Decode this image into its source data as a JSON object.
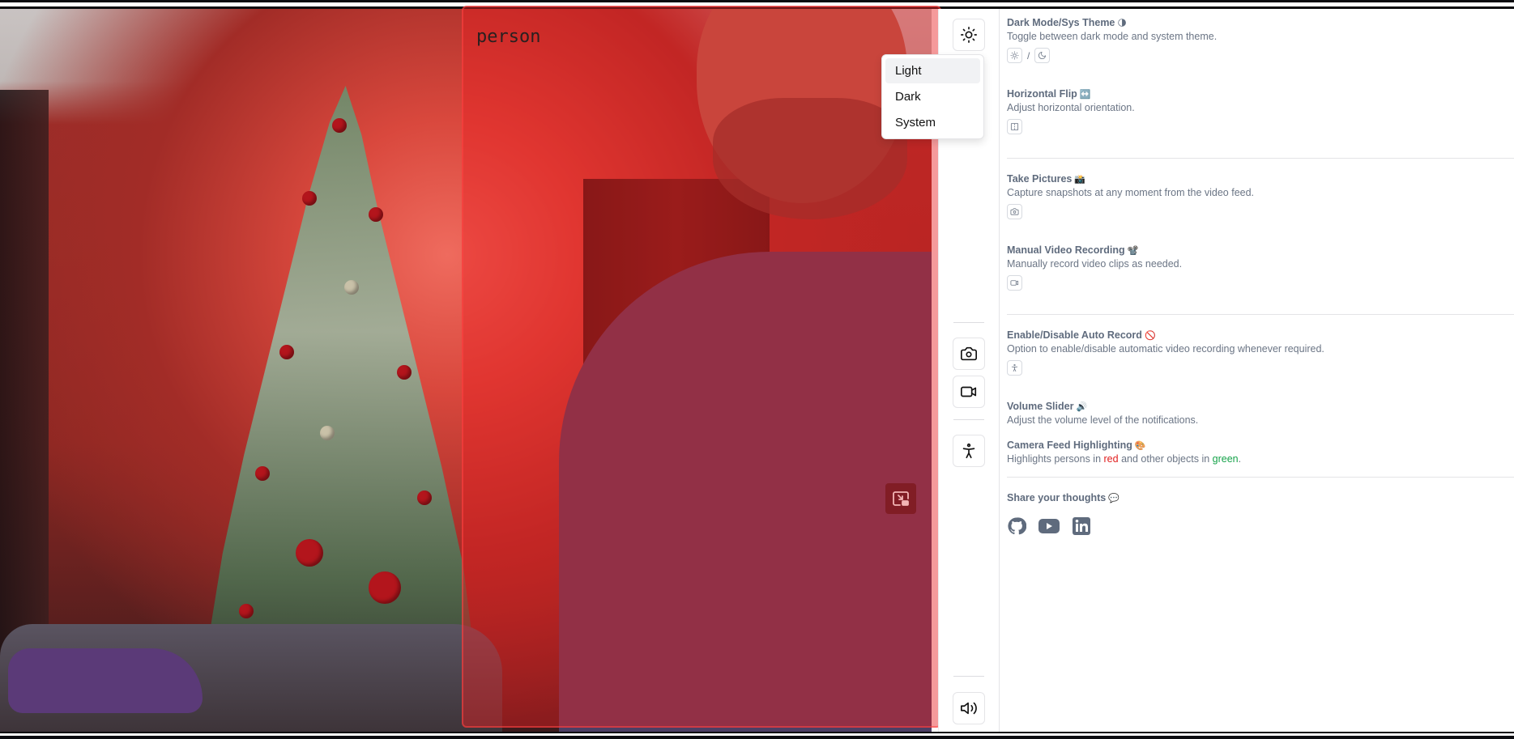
{
  "app": {
    "detection_label": "person",
    "accent_colors": {
      "person_highlight": "#e82022",
      "other_highlight": "#16a34a"
    }
  },
  "toolbar": {
    "theme_icon": "sun-icon",
    "capture_icon": "camera-icon",
    "record_icon": "video-icon",
    "autorecord_icon": "person-icon",
    "volume_icon": "volume-icon",
    "pip_icon": "picture-in-picture-icon"
  },
  "theme_menu": {
    "items": [
      {
        "label": "Light",
        "selected": true
      },
      {
        "label": "Dark",
        "selected": false
      },
      {
        "label": "System",
        "selected": false
      }
    ]
  },
  "panel": {
    "dark_mode": {
      "title": "Dark Mode/Sys Theme",
      "emoji": "🌗",
      "desc": "Toggle between dark mode and system theme.",
      "separator": "/"
    },
    "flip": {
      "title": "Horizontal Flip",
      "emoji": "↔️",
      "desc": "Adjust horizontal orientation."
    },
    "pictures": {
      "title": "Take Pictures",
      "emoji": "📸",
      "desc": "Capture snapshots at any moment from the video feed."
    },
    "recording": {
      "title": "Manual Video Recording",
      "emoji": "📽️",
      "desc": "Manually record video clips as needed."
    },
    "auto_record": {
      "title": "Enable/Disable Auto Record",
      "emoji": "🚫",
      "desc": "Option to enable/disable automatic video recording whenever required."
    },
    "volume": {
      "title": "Volume Slider",
      "emoji": "🔊",
      "desc": "Adjust the volume level of the notifications."
    },
    "highlight": {
      "title": "Camera Feed Highlighting",
      "emoji": "🎨",
      "desc_before": "Highlights persons in ",
      "desc_red": "red",
      "desc_middle": " and other objects in ",
      "desc_green": "green",
      "desc_after": "."
    },
    "share": {
      "title": "Share your thoughts",
      "emoji": "💬",
      "icons": [
        "github-icon",
        "youtube-icon",
        "linkedin-icon"
      ]
    }
  }
}
